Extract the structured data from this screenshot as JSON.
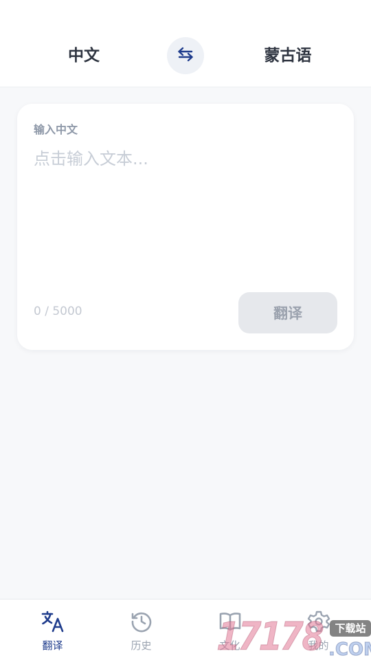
{
  "header": {
    "source_language": "中文",
    "target_language": "蒙古语",
    "swap_icon": "swap-arrows-icon"
  },
  "input_card": {
    "label": "输入中文",
    "placeholder": "点击输入文本...",
    "value": "",
    "char_count": "0 / 5000",
    "translate_button": "翻译"
  },
  "tabbar": {
    "tabs": [
      {
        "label": "翻译",
        "icon": "translate-icon",
        "active": true
      },
      {
        "label": "历史",
        "icon": "history-icon",
        "active": false
      },
      {
        "label": "文化",
        "icon": "book-icon",
        "active": false
      },
      {
        "label": "我的",
        "icon": "gear-icon",
        "active": false
      }
    ]
  },
  "watermark": {
    "digits": "17178",
    "badge": "下载站",
    "domain": ".COM"
  },
  "colors": {
    "accent": "#1f3c8c",
    "background": "#f7f8fa",
    "text": "#2e3440",
    "muted": "#9aa3b0",
    "button_disabled": "#e6e8ec"
  }
}
